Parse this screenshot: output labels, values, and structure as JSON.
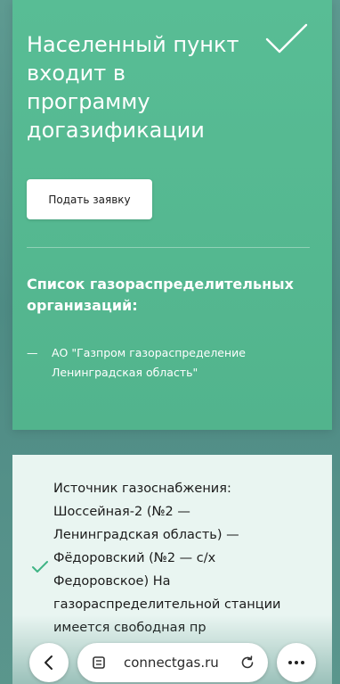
{
  "status_card": {
    "title": "Населенный пункт входит в программу догазификации",
    "apply_button": "Подать заявку",
    "list_heading": "Список газораспределительных организаций:",
    "organizations": [
      {
        "dash": "—",
        "name": "АО \"Газпром газораспределение Ленинградская область\""
      }
    ],
    "icon": "checkmark-icon"
  },
  "source_card": {
    "text": "Источник газоснабжения: Шоссейная-2 (№2 — Ленинградская область) — Фёдоровский (№2 — с/х Федоровское) На газораспределительной станции имеется свободная пр",
    "icon": "checkmark-icon"
  },
  "browser_bar": {
    "url": "connectgas.ru",
    "icons": [
      "back-icon",
      "tabs-icon",
      "reload-icon",
      "more-icon"
    ]
  },
  "colors": {
    "accent_green": "#56b891",
    "light_card": "#e9f5f1",
    "check_small": "#3fb485"
  }
}
